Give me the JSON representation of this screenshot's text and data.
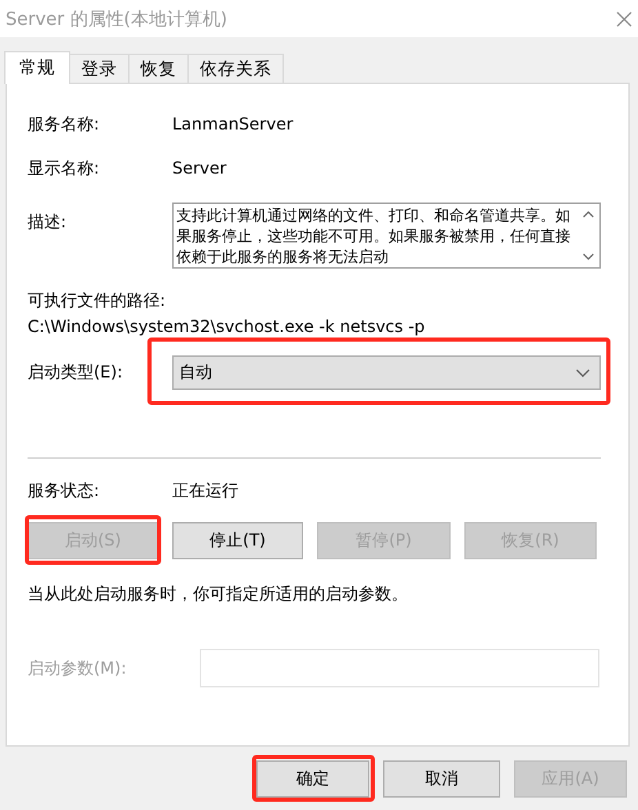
{
  "window": {
    "title": "Server 的属性(本地计算机)"
  },
  "tabs": [
    {
      "label": "常规",
      "selected": true
    },
    {
      "label": "登录",
      "selected": false
    },
    {
      "label": "恢复",
      "selected": false
    },
    {
      "label": "依存关系",
      "selected": false
    }
  ],
  "general": {
    "service_name": {
      "label": "服务名称:",
      "value": "LanmanServer"
    },
    "display_name": {
      "label": "显示名称:",
      "value": "Server"
    },
    "description": {
      "label": "描述:",
      "value": "支持此计算机通过网络的文件、打印、和命名管道共享。如果服务停止，这些功能不可用。如果服务被禁用，任何直接依赖于此服务的服务将无法启动"
    },
    "path": {
      "label": "可执行文件的路径:",
      "value": "C:\\Windows\\system32\\svchost.exe -k netsvcs -p"
    },
    "startup_type": {
      "label": "启动类型(E):",
      "value": "自动",
      "highlighted": true
    },
    "service_status": {
      "label": "服务状态:",
      "value": "正在运行"
    },
    "service_buttons": [
      {
        "label": "启动(S)",
        "disabled": true,
        "highlighted": true
      },
      {
        "label": "停止(T)",
        "disabled": false,
        "highlighted": false
      },
      {
        "label": "暂停(P)",
        "disabled": true,
        "highlighted": false
      },
      {
        "label": "恢复(R)",
        "disabled": true,
        "highlighted": false
      }
    ],
    "hint": "当从此处启动服务时，你可指定所适用的启动参数。",
    "start_parameters": {
      "label": "启动参数(M):",
      "disabled": true
    }
  },
  "buttons": [
    {
      "label": "确定",
      "disabled": false,
      "highlighted": true
    },
    {
      "label": "取消",
      "disabled": false,
      "highlighted": false
    },
    {
      "label": "应用(A)",
      "disabled": true,
      "highlighted": false
    }
  ]
}
